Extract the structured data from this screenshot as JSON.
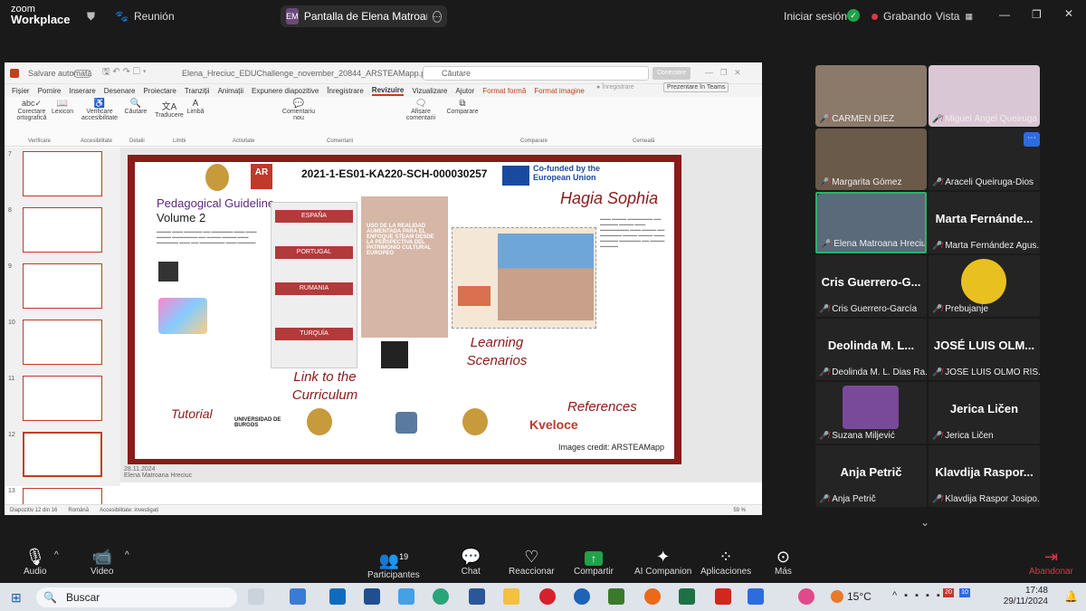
{
  "zoom": {
    "brand_line1": "zoom",
    "brand_line2": "Workplace",
    "meeting_label": "Reunión",
    "share_pill_initials": "EM",
    "share_pill_label": "Pantalla de Elena Matroana Hrec",
    "signin_label": "Iniciar sesión",
    "recording_label": "Grabando",
    "view_label": "Vista"
  },
  "ppt": {
    "autosave": "Salvare automată",
    "filename": "Elena_Hreciuc_EDUChallenge_november_20844_ARSTEAMapp.p... • Salvat în acest PC",
    "search": "Căutare",
    "connect_btn": "Conectare",
    "menu": [
      "Fișier",
      "Pornire",
      "Inserare",
      "Desenare",
      "Proiectare",
      "Tranziții",
      "Animații",
      "Expunere diapozitive",
      "Înregistrare",
      "Revizuire",
      "Vizualizare",
      "Ajutor",
      "Format formă",
      "Format imagine"
    ],
    "record_btn": "Înregistrare",
    "present_teams": "Prezentare în Teams",
    "ribbon": {
      "spelling": "Corectare ortografică",
      "thesaurus": "Lexicon",
      "check_access": "Verificare accesibilitate",
      "search": "Căutare",
      "translate": "Traducere",
      "language": "Limbă",
      "new_comment": "Comentariu nou",
      "show_comments": "Afișare comentarii",
      "compare": "Comparare",
      "groups": [
        "Verificare",
        "Accesibilitate",
        "Detalii",
        "Limbi",
        "Activitate",
        "Comentarii",
        "Comparare",
        "Cerneală"
      ]
    },
    "thumb_numbers": [
      "7",
      "8",
      "9",
      "10",
      "11",
      "12",
      "13"
    ],
    "status_slide": "Diapozitiv 12 din 16",
    "status_lang": "Română",
    "status_access": "Accesibilitate: investigați",
    "zoom_level": "59 %",
    "notes_date": "28.11.2024",
    "notes_author": "Elena Matroana Hreciuc"
  },
  "slide": {
    "project_code": "2021-1-ES01-KA220-SCH-000030257",
    "eu_text": "Co-funded by the European Union",
    "guideline_title": "Pedagogical Guideline",
    "guideline_volume": "Volume 2",
    "hagia": "Hagia Sophia",
    "learning": "Learning Scenarios",
    "link_curriculum": "Link to the Curriculum",
    "tutorial": "Tutorial",
    "references": "References",
    "credit": "Images credit: ARSTEAMapp",
    "countries": [
      "ESPAÑA",
      "PORTUGAL",
      "RUMANIA",
      "TURQUÍA"
    ],
    "burgos": "UNIVERSIDAD DE BURGOS",
    "book_title": "USO DE LA REALIDAD AUMENTADA PARA EL ENFOQUE STEAM DESDE LA PERSPECTIVA DEL PATRIMONIO CULTURAL EUROPEO"
  },
  "participants": [
    {
      "name": "CARMEN DIEZ",
      "big": ""
    },
    {
      "name": "Miguel Ángel Queiruga Di...",
      "big": ""
    },
    {
      "name": "Margarita Gómez",
      "big": ""
    },
    {
      "name": "Araceli Queiruga-Dios",
      "big": ""
    },
    {
      "name": "Elena Matroana Hreciuc",
      "big": ""
    },
    {
      "name": "Marta Fernández Agus...",
      "big": "Marta Fernánde..."
    },
    {
      "name": "Cris Guerrero-García",
      "big": "Cris Guerrero-G..."
    },
    {
      "name": "Prebujanje",
      "big": ""
    },
    {
      "name": "Deolinda M. L. Dias Ra...",
      "big": "Deolinda M. L..."
    },
    {
      "name": "JOSÉ LUIS OLMO RÍS...",
      "big": "JOSÉ LUIS OLM..."
    },
    {
      "name": "Suzana Miljević",
      "big": ""
    },
    {
      "name": "Jerica Ličen",
      "big": "Jerica Ličen"
    },
    {
      "name": "Anja Petrič",
      "big": "Anja Petrič"
    },
    {
      "name": "Klavdija Raspor Josipo...",
      "big": "Klavdija Raspor..."
    }
  ],
  "toolbar": {
    "audio": "Audio",
    "video": "Video",
    "participants": "Participantes",
    "participants_count": "19",
    "chat": "Chat",
    "react": "Reaccionar",
    "share": "Compartir",
    "ai": "AI Companion",
    "apps": "Aplicaciones",
    "more": "Más",
    "leave": "Abandonar"
  },
  "taskbar": {
    "search": "Buscar",
    "weather": "15°C",
    "time": "17:48",
    "date": "29/11/2024",
    "mail_badge": "20",
    "chat_badge": "10"
  }
}
